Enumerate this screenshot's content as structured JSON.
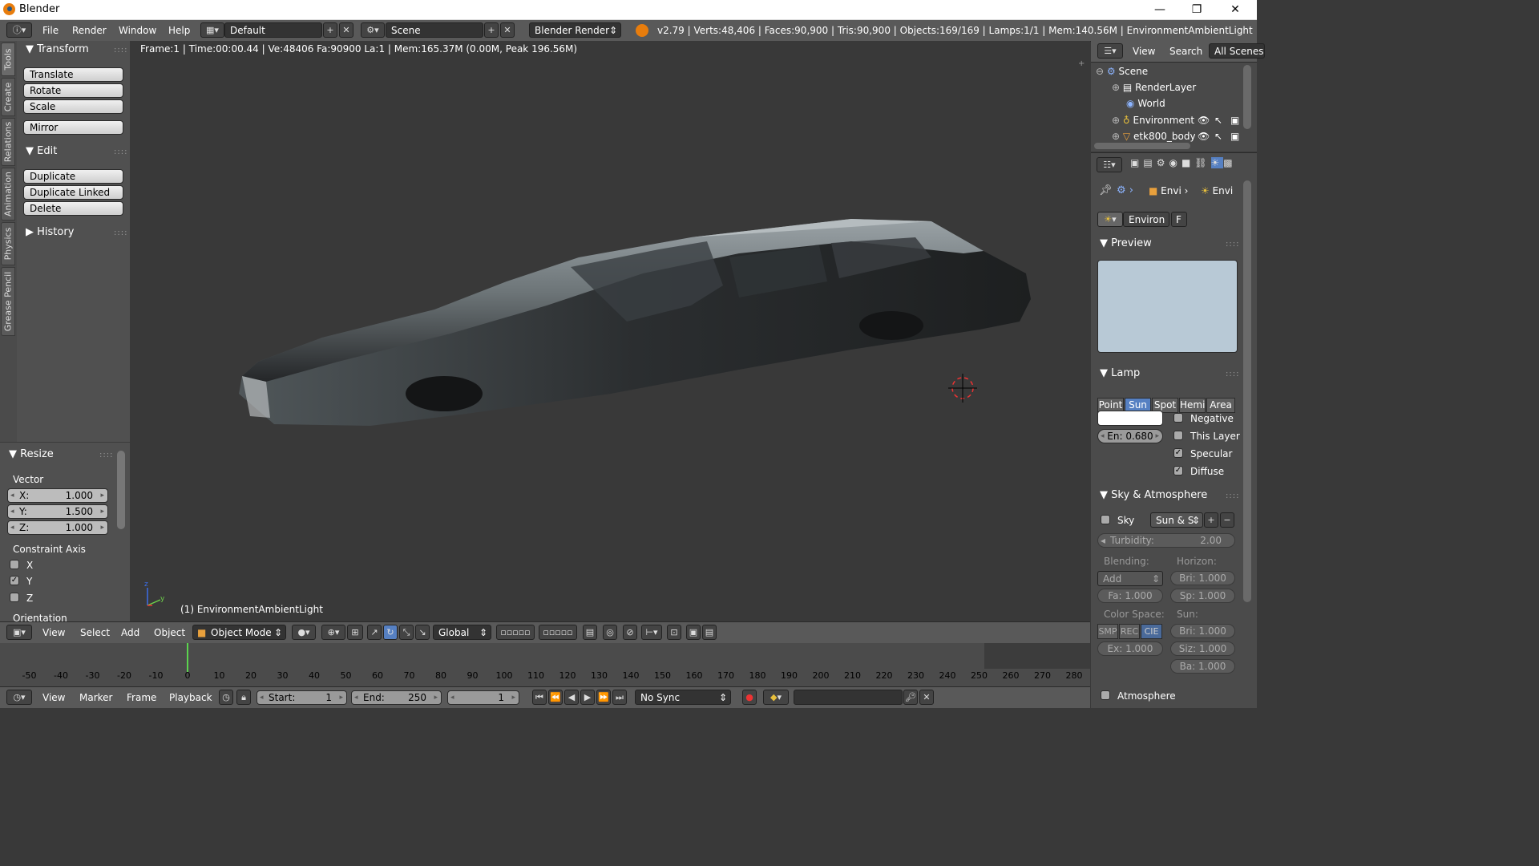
{
  "window": {
    "title": "Blender"
  },
  "menus": [
    "File",
    "Render",
    "Window",
    "Help"
  ],
  "layout": {
    "screen": "Default",
    "scene": "Scene",
    "engine": "Blender Render"
  },
  "stats": "v2.79 | Verts:48,406 | Faces:90,900 | Tris:90,900 | Objects:169/169 | Lamps:1/1 | Mem:140.56M | EnvironmentAmbientLight",
  "toolshelf": {
    "tabs": [
      "Tools",
      "Create",
      "Relations",
      "Animation",
      "Physics",
      "Grease Pencil"
    ],
    "transform_header": "Transform",
    "transform_buttons": [
      "Translate",
      "Rotate",
      "Scale"
    ],
    "mirror": "Mirror",
    "edit_header": "Edit",
    "edit_buttons": [
      "Duplicate",
      "Duplicate Linked",
      "Delete"
    ],
    "history_header": "History"
  },
  "redo": {
    "header": "Resize",
    "vector_label": "Vector",
    "x": {
      "label": "X:",
      "value": "1.000"
    },
    "y": {
      "label": "Y:",
      "value": "1.500"
    },
    "z": {
      "label": "Z:",
      "value": "1.000"
    },
    "constraint_label": "Constraint Axis",
    "constraint_x": "X",
    "constraint_y": "Y",
    "constraint_z": "Z",
    "constraint_checked": {
      "x": false,
      "y": true,
      "z": false
    },
    "orientation_label": "Orientation"
  },
  "viewport": {
    "info": "Frame:1 | Time:00:00.44 | Ve:48406 Fa:90900 La:1 | Mem:165.37M (0.00M, Peak 196.56M)",
    "object_label": "(1) EnvironmentAmbientLight"
  },
  "view3d_header": {
    "menus": [
      "View",
      "Select",
      "Add",
      "Object"
    ],
    "mode": "Object Mode",
    "orientation": "Global"
  },
  "timeline": {
    "ticks": [
      "-50",
      "-40",
      "-30",
      "-20",
      "-10",
      "0",
      "10",
      "20",
      "30",
      "40",
      "50",
      "60",
      "70",
      "80",
      "90",
      "100",
      "110",
      "120",
      "130",
      "140",
      "150",
      "160",
      "170",
      "180",
      "190",
      "200",
      "210",
      "220",
      "230",
      "240",
      "250",
      "260",
      "270",
      "280"
    ],
    "menus": [
      "View",
      "Marker",
      "Frame",
      "Playback"
    ],
    "start_label": "Start:",
    "start": "1",
    "end_label": "End:",
    "end": "250",
    "current": "1",
    "sync": "No Sync"
  },
  "outliner": {
    "menus": [
      "View",
      "Search"
    ],
    "filter": "All Scenes",
    "items": [
      "Scene",
      "RenderLayer",
      "World",
      "Environment",
      "etk800_body"
    ]
  },
  "properties": {
    "breadcrumb1": "Envi",
    "breadcrumb2": "Envi",
    "datablock": "Environ",
    "fake_user": "F",
    "preview_header": "Preview",
    "lamp_header": "Lamp",
    "lamp_types": [
      "Point",
      "Sun",
      "Spot",
      "Hemi",
      "Area"
    ],
    "lamp_active": "Sun",
    "energy": "En: 0.680",
    "negative": "Negative",
    "this_layer": "This Layer",
    "specular": "Specular",
    "diffuse": "Diffuse",
    "sky_header": "Sky & Atmosphere",
    "sky": "Sky",
    "sky_preset": "Sun & S",
    "turbidity": "Turbidity:",
    "turbidity_value": "2.00",
    "blending": "Blending:",
    "horizon": "Horizon:",
    "blend_mode": "Add",
    "h_bri": "Bri: 1.000",
    "fa": "Fa: 1.000",
    "sp": "Sp: 1.000",
    "color_space": "Color Space:",
    "sun": "Sun:",
    "cs": [
      "SMP",
      "REC",
      "CIE"
    ],
    "s_bri": "Bri: 1.000",
    "ex": "Ex: 1.000",
    "siz": "Siz: 1.000",
    "ba": "Ba: 1.000",
    "atmosphere": "Atmosphere"
  }
}
